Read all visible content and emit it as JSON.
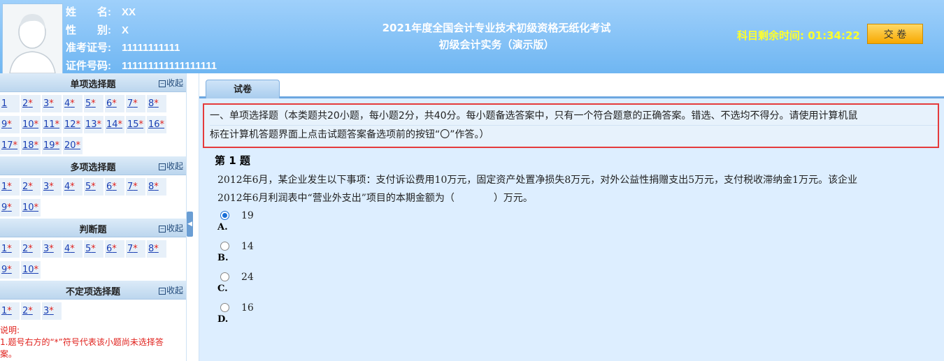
{
  "header": {
    "fields": [
      {
        "label": "姓　　名:",
        "value": "XX"
      },
      {
        "label": "性　　别:",
        "value": "X"
      },
      {
        "label": "准考证号:",
        "value": "11111111111"
      },
      {
        "label": "证件号码:",
        "value": "111111111111111111"
      }
    ],
    "title_line1": "2021年度全国会计专业技术初级资格无纸化考试",
    "title_line2": "初级会计实务（演示版）",
    "timer_label": "科目剩余时间:",
    "timer_value": "01:34:22",
    "submit_label": "交 卷",
    "avatar_icon": "user-silhouette-icon"
  },
  "sidebar": {
    "sections": [
      {
        "title": "单项选择题",
        "collapse": "收起",
        "items": [
          {
            "n": "1",
            "star": ""
          },
          {
            "n": "2",
            "star": "*"
          },
          {
            "n": "3",
            "star": "*"
          },
          {
            "n": "4",
            "star": "*"
          },
          {
            "n": "5",
            "star": "*"
          },
          {
            "n": "6",
            "star": "*"
          },
          {
            "n": "7",
            "star": "*"
          },
          {
            "n": "8",
            "star": "*"
          },
          {
            "n": "9",
            "star": "*"
          },
          {
            "n": "10",
            "star": "*"
          },
          {
            "n": "11",
            "star": "*"
          },
          {
            "n": "12",
            "star": "*"
          },
          {
            "n": "13",
            "star": "*"
          },
          {
            "n": "14",
            "star": "*"
          },
          {
            "n": "15",
            "star": "*"
          },
          {
            "n": "16",
            "star": "*"
          },
          {
            "n": "17",
            "star": "*"
          },
          {
            "n": "18",
            "star": "*"
          },
          {
            "n": "19",
            "star": "*"
          },
          {
            "n": "20",
            "star": "*"
          }
        ]
      },
      {
        "title": "多项选择题",
        "collapse": "收起",
        "items": [
          {
            "n": "1",
            "star": "*"
          },
          {
            "n": "2",
            "star": "*"
          },
          {
            "n": "3",
            "star": "*"
          },
          {
            "n": "4",
            "star": "*"
          },
          {
            "n": "5",
            "star": "*"
          },
          {
            "n": "6",
            "star": "*"
          },
          {
            "n": "7",
            "star": "*"
          },
          {
            "n": "8",
            "star": "*"
          },
          {
            "n": "9",
            "star": "*"
          },
          {
            "n": "10",
            "star": "*"
          }
        ]
      },
      {
        "title": "判断题",
        "collapse": "收起",
        "items": [
          {
            "n": "1",
            "star": "*"
          },
          {
            "n": "2",
            "star": "*"
          },
          {
            "n": "3",
            "star": "*"
          },
          {
            "n": "4",
            "star": "*"
          },
          {
            "n": "5",
            "star": "*"
          },
          {
            "n": "6",
            "star": "*"
          },
          {
            "n": "7",
            "star": "*"
          },
          {
            "n": "8",
            "star": "*"
          },
          {
            "n": "9",
            "star": "*"
          },
          {
            "n": "10",
            "star": "*"
          }
        ]
      },
      {
        "title": "不定项选择题",
        "collapse": "收起",
        "items": [
          {
            "n": "1",
            "star": "*"
          },
          {
            "n": "2",
            "star": "*"
          },
          {
            "n": "3",
            "star": "*"
          }
        ]
      }
    ],
    "note_line1": "说明:",
    "note_line2": "1.题号右方的“*”符号代表该小题尚未选择答",
    "note_line3": "案。"
  },
  "main": {
    "tab_label": "试卷",
    "instruction_line1": "一、单项选择题（本类题共20小题，每小题2分，共40分。每小题备选答案中，只有一个符合题意的正确答案。错选、不选均不得分。请使用计算机鼠",
    "instruction_line2": "标在计算机答题界面上点击试题答案备选项前的按钮“〇”作答。）",
    "question_title": "第 1 题",
    "question_line1": "2012年6月，某企业发生以下事项：支付诉讼费用10万元，固定资产处置净损失8万元，对外公益性捐赠支出5万元，支付税收滞纳金1万元。该企业",
    "question_line2": "2012年6月利润表中“营业外支出”项目的本期金额为（　　　　）万元。",
    "options": [
      {
        "value": "19",
        "letter": "A.",
        "selected": true
      },
      {
        "value": "14",
        "letter": "B.",
        "selected": false
      },
      {
        "value": "24",
        "letter": "C.",
        "selected": false
      },
      {
        "value": "16",
        "letter": "D.",
        "selected": false
      }
    ]
  },
  "colors": {
    "header_bg": "#7dbdf4",
    "timer": "#ffff2a",
    "submit_bg": "#f7b500",
    "highlight_border": "#e53b3b",
    "star": "#e0221d"
  }
}
